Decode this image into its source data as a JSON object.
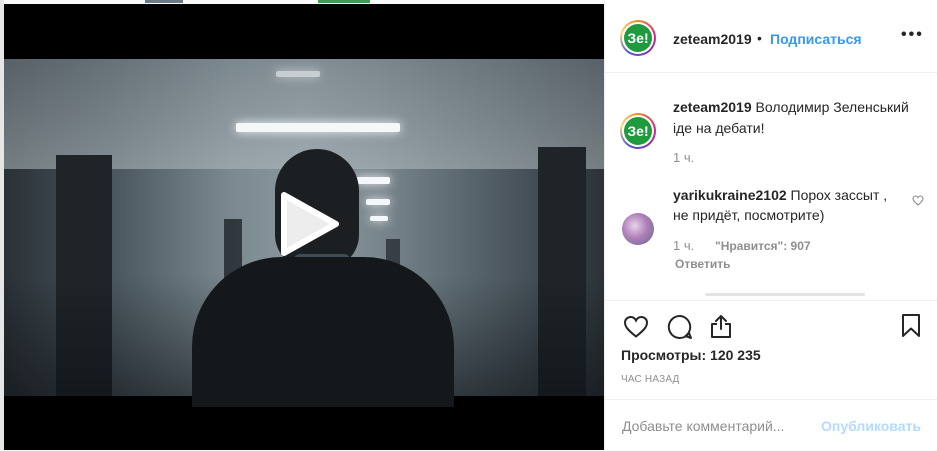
{
  "post": {
    "username": "zeteam2019",
    "follow_label": "Подписаться",
    "more_label": "•••",
    "avatar_text": "Зе!",
    "caption_text": "Володимир Зеленський іде на дебати!",
    "caption_time": "1 ч."
  },
  "comment": {
    "username": "yarikukraine2102",
    "text": "Порох зассыт , не придёт, посмотрите)",
    "time": "1 ч.",
    "likes": "\"Нравится\": 907",
    "reply_label": "Ответить"
  },
  "stats": {
    "views": "Просмотры: 120 235",
    "posted": "ЧАС НАЗАД"
  },
  "composer": {
    "placeholder": "Добавьте комментарий...",
    "publish_label": "Опубликовать"
  },
  "colors": {
    "accent": "#3897f0",
    "brand_green": "#1f9a3f",
    "publish_disabled": "#b3dbff"
  },
  "icons": [
    "play-icon",
    "more-icon",
    "heart-icon",
    "comment-icon",
    "share-icon",
    "bookmark-icon",
    "comment-like-icon"
  ]
}
